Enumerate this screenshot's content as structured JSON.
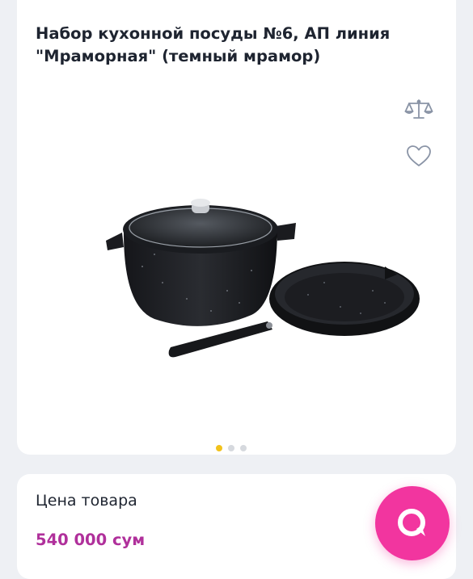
{
  "product": {
    "title": "Набор кухонной посуды №6, АП линия \"Мраморная\" (темный мрамор)",
    "gallery": {
      "slide_count": 3,
      "active_slide": 1
    }
  },
  "actions": {
    "compare_icon": "scales-icon",
    "favorite_icon": "heart-icon"
  },
  "price": {
    "label": "Цена товара",
    "value": "540 000 сум"
  },
  "chat": {
    "icon": "chat-bubble-icon"
  },
  "colors": {
    "accent_price": "#b0309b",
    "chat_button": "#f2359f",
    "active_dot": "#f2c21b",
    "icon_stroke": "#8a94a6"
  }
}
